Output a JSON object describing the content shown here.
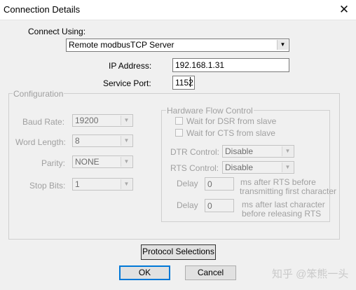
{
  "window": {
    "title": "Connection Details",
    "close_glyph": "✕"
  },
  "connect_using": {
    "label": "Connect Using:",
    "value": "Remote modbusTCP Server"
  },
  "ip_address": {
    "label": "IP Address:",
    "value": "192.168.1.31"
  },
  "service_port": {
    "label": "Service Port:",
    "value": "1152"
  },
  "configuration": {
    "title": "Configuration",
    "baud_rate": {
      "label": "Baud Rate:",
      "value": "19200"
    },
    "word_length": {
      "label": "Word Length:",
      "value": "8"
    },
    "parity": {
      "label": "Parity:",
      "value": "NONE"
    },
    "stop_bits": {
      "label": "Stop Bits:",
      "value": "1"
    }
  },
  "hardware_flow": {
    "title": "Hardware Flow Control",
    "wait_dsr": "Wait for DSR from slave",
    "wait_cts": "Wait for CTS from slave",
    "dtr_control": {
      "label": "DTR Control:",
      "value": "Disable"
    },
    "rts_control": {
      "label": "RTS Control:",
      "value": "Disable"
    },
    "delay1": {
      "label": "Delay",
      "value": "0",
      "desc_line1": "ms after RTS before",
      "desc_line2": "transmitting first character"
    },
    "delay2": {
      "label": "Delay",
      "value": "0",
      "desc_line1": "ms after last character",
      "desc_line2": "before releasing RTS"
    }
  },
  "buttons": {
    "protocol": "Protocol Selections",
    "ok": "OK",
    "cancel": "Cancel"
  },
  "watermark": "知乎 @笨熊一头",
  "icons": {
    "dropdown": "▼"
  }
}
